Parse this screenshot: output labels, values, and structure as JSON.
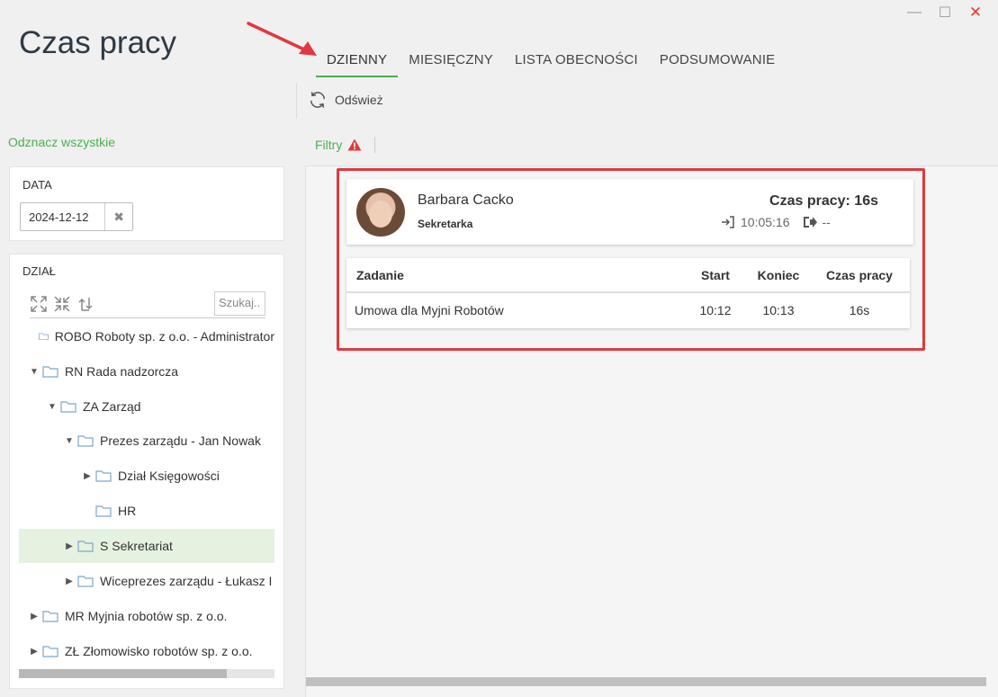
{
  "app": {
    "title": "Czas pracy"
  },
  "window_controls": {
    "minimize": "—",
    "maximize": "☐",
    "close": "✕"
  },
  "tabs": [
    {
      "label": "DZIENNY",
      "active": true
    },
    {
      "label": "MIESIĘCZNY",
      "active": false
    },
    {
      "label": "LISTA OBECNOŚCI",
      "active": false
    },
    {
      "label": "PODSUMOWANIE",
      "active": false
    }
  ],
  "toolbar": {
    "refresh_label": "Odśwież",
    "refresh_icon": "refresh-icon"
  },
  "sidebar": {
    "select_all": "Odznacz wszystkie",
    "date_section": {
      "label": "DATA",
      "value": "2024-12-12",
      "clear_icon": "✖"
    },
    "dept_section": {
      "label": "DZIAŁ",
      "search_placeholder": "Szukaj..",
      "tree": [
        {
          "label": "ROBO Roboty sp. z o.o. - Administrator",
          "level": 0,
          "toggle": "none",
          "selected": false
        },
        {
          "label": "RN Rada nadzorcza",
          "level": 0,
          "toggle": "expanded",
          "selected": false
        },
        {
          "label": "ZA Zarząd",
          "level": 1,
          "toggle": "expanded",
          "selected": false
        },
        {
          "label": "Prezes zarządu - Jan Nowak",
          "level": 2,
          "toggle": "expanded",
          "selected": false
        },
        {
          "label": "Dział Księgowości",
          "level": 3,
          "toggle": "collapsed",
          "selected": false
        },
        {
          "label": "HR",
          "level": 3,
          "toggle": "none",
          "selected": false
        },
        {
          "label": "S Sekretariat",
          "level": 2,
          "toggle": "collapsed",
          "selected": true
        },
        {
          "label": "Wiceprezes zarządu - Łukasz I",
          "level": 2,
          "toggle": "collapsed",
          "selected": false
        },
        {
          "label": "MR Myjnia robotów sp. z o.o.",
          "level": 0,
          "toggle": "collapsed",
          "selected": false
        },
        {
          "label": "ZŁ Złomowisko robotów sp. z o.o.",
          "level": 0,
          "toggle": "collapsed",
          "selected": false
        }
      ]
    }
  },
  "filters": {
    "label": "Filtry",
    "warning_icon": "warning-icon"
  },
  "employee": {
    "name": "Barbara Cacko",
    "role": "Sekretarka",
    "work_time": "Czas pracy: 16s",
    "clock_in": "10:05:16",
    "clock_out": "--"
  },
  "tasks_table": {
    "columns": [
      "Zadanie",
      "Start",
      "Koniec",
      "Czas pracy"
    ],
    "rows": [
      [
        "Umowa dla Myjni Robotów",
        "10:12",
        "10:13",
        "16s"
      ]
    ]
  },
  "colors": {
    "accent": "#4caf50",
    "highlight": "#e0393e",
    "selected_row": "#e5f2df"
  }
}
